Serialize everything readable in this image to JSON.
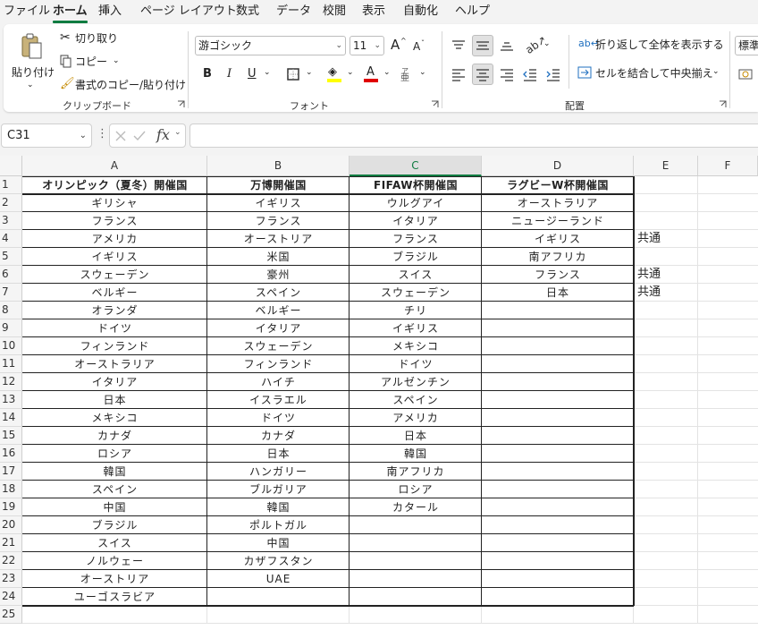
{
  "menu": {
    "tabs": [
      "ファイル",
      "ホーム",
      "挿入",
      "ページ レイアウト",
      "数式",
      "データ",
      "校閲",
      "表示",
      "自動化",
      "ヘルプ"
    ],
    "active": "ホーム"
  },
  "ribbon": {
    "clipboard": {
      "paste": "貼り付け",
      "cut": "切り取り",
      "copy": "コピー",
      "format_painter": "書式のコピー/貼り付け",
      "label": "クリップボード"
    },
    "font": {
      "font_name": "游ゴシック",
      "font_size": "11",
      "bold": "B",
      "italic": "I",
      "underline": "U",
      "grow": "A",
      "shrink": "A",
      "font_color_letter": "A",
      "label": "フォント"
    },
    "alignment": {
      "wrap_text": "折り返して全体を表示する",
      "merge_center": "セルを結合して中央揃え",
      "label": "配置"
    },
    "number": {
      "format": "標準"
    }
  },
  "formula_bar": {
    "name_box": "C31",
    "fx": "fx",
    "formula": ""
  },
  "sheet": {
    "columns": [
      "A",
      "B",
      "C",
      "D",
      "E",
      "F"
    ],
    "selected_column": "C",
    "rows": [
      "1",
      "2",
      "3",
      "4",
      "5",
      "6",
      "7",
      "8",
      "9",
      "10",
      "11",
      "12",
      "13",
      "14",
      "15",
      "16",
      "17",
      "18",
      "19",
      "20",
      "21",
      "22",
      "23",
      "24",
      "25"
    ],
    "headers": {
      "A": "オリンピック（夏冬）開催国",
      "B": "万博開催国",
      "C": "FIFAW杯開催国",
      "D": "ラグビーW杯開催国"
    },
    "colA": [
      "ギリシャ",
      "フランス",
      "アメリカ",
      "イギリス",
      "スウェーデン",
      "ベルギー",
      "オランダ",
      "ドイツ",
      "フィンランド",
      "オーストラリア",
      "イタリア",
      "日本",
      "メキシコ",
      "カナダ",
      "ロシア",
      "韓国",
      "スペイン",
      "中国",
      "ブラジル",
      "スイス",
      "ノルウェー",
      "オーストリア",
      "ユーゴスラビア"
    ],
    "colB": [
      "イギリス",
      "フランス",
      "オーストリア",
      "米国",
      "豪州",
      "スペイン",
      "ベルギー",
      "イタリア",
      "スウェーデン",
      "フィンランド",
      "ハイチ",
      "イスラエル",
      "ドイツ",
      "カナダ",
      "日本",
      "ハンガリー",
      "ブルガリア",
      "韓国",
      "ポルトガル",
      "中国",
      "カザフスタン",
      "UAE",
      ""
    ],
    "colC": [
      "ウルグアイ",
      "イタリア",
      "フランス",
      "ブラジル",
      "スイス",
      "スウェーデン",
      "チリ",
      "イギリス",
      "メキシコ",
      "ドイツ",
      "アルゼンチン",
      "スペイン",
      "アメリカ",
      "日本",
      "韓国",
      "南アフリカ",
      "ロシア",
      "カタール",
      "",
      "",
      "",
      "",
      ""
    ],
    "colD": [
      "オーストラリア",
      "ニュージーランド",
      "イギリス",
      "南アフリカ",
      "フランス",
      "日本",
      "",
      "",
      "",
      "",
      "",
      "",
      "",
      "",
      "",
      "",
      "",
      "",
      "",
      "",
      "",
      "",
      ""
    ],
    "colE": [
      "",
      "",
      "共通",
      "",
      "共通",
      "共通",
      "",
      "",
      "",
      "",
      "",
      "",
      "",
      "",
      "",
      "",
      "",
      "",
      "",
      "",
      "",
      "",
      ""
    ]
  }
}
